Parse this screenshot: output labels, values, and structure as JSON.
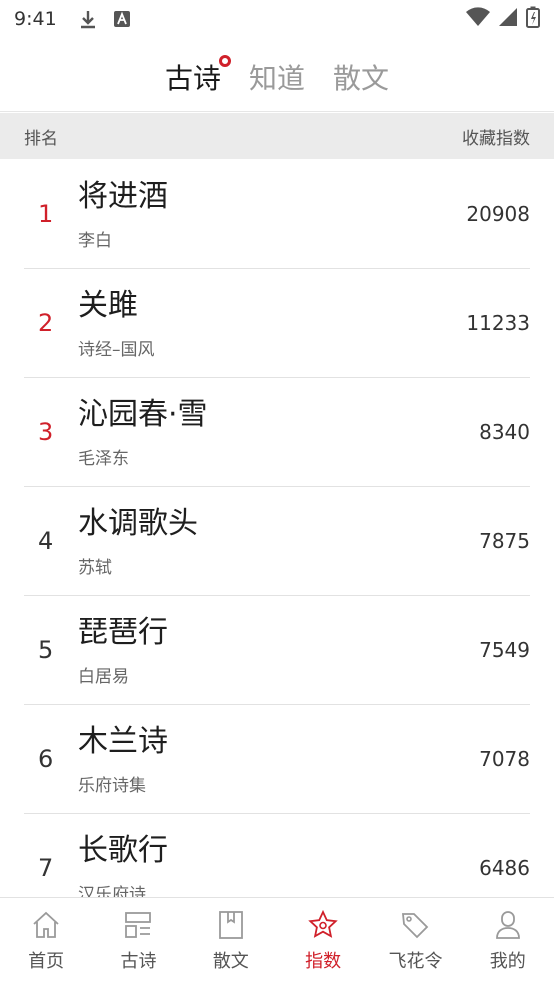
{
  "status_bar": {
    "time": "9:41"
  },
  "top_tabs": [
    {
      "label": "古诗",
      "active": true
    },
    {
      "label": "知道",
      "active": false
    },
    {
      "label": "散文",
      "active": false
    }
  ],
  "table_header": {
    "left": "排名",
    "right": "收藏指数"
  },
  "rows": [
    {
      "rank": "1",
      "title": "将进酒",
      "author": "李白",
      "score": "20908"
    },
    {
      "rank": "2",
      "title": "关雎",
      "author": "诗经–国风",
      "score": "11233"
    },
    {
      "rank": "3",
      "title": "沁园春·雪",
      "author": "毛泽东",
      "score": "8340"
    },
    {
      "rank": "4",
      "title": "水调歌头",
      "author": "苏轼",
      "score": "7875"
    },
    {
      "rank": "5",
      "title": "琵琶行",
      "author": "白居易",
      "score": "7549"
    },
    {
      "rank": "6",
      "title": "木兰诗",
      "author": "乐府诗集",
      "score": "7078"
    },
    {
      "rank": "7",
      "title": "长歌行",
      "author": "汉乐府诗",
      "score": "6486"
    }
  ],
  "bottom_nav": [
    {
      "label": "首页",
      "icon": "home-icon",
      "active": false
    },
    {
      "label": "古诗",
      "icon": "poem-grid-icon",
      "active": false
    },
    {
      "label": "散文",
      "icon": "bookmark-book-icon",
      "active": false
    },
    {
      "label": "指数",
      "icon": "star-icon",
      "active": true
    },
    {
      "label": "飞花令",
      "icon": "tag-icon",
      "active": false
    },
    {
      "label": "我的",
      "icon": "user-icon",
      "active": false
    }
  ],
  "colors": {
    "accent": "#d0202a",
    "header_bg": "#ebebeb"
  }
}
